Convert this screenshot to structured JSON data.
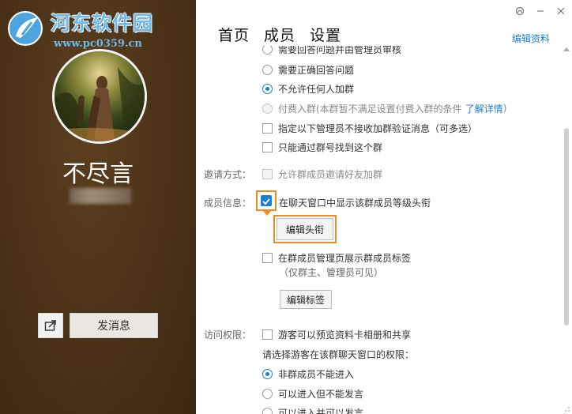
{
  "watermark": {
    "site_name": "河东软件园",
    "site_url": "www.pc0359.cn"
  },
  "profile": {
    "username": "不尽言"
  },
  "actions": {
    "send_message": "发消息"
  },
  "nav": {
    "tabs": [
      "首页",
      "成员",
      "设置"
    ],
    "edit_profile": "编辑资料"
  },
  "join_options": [
    {
      "label": "需要回答问题并由管理员审核",
      "state": "partial"
    },
    {
      "label": "需要正确回答问题",
      "state": "unchecked"
    },
    {
      "label": "不允许任何人加群",
      "state": "checked"
    },
    {
      "label": "付费入群(本群暂不满足设置付费入群的条件",
      "link": "了解详情",
      "suffix": ")",
      "state": "disabled"
    }
  ],
  "join_checks": [
    "指定以下管理员不接收加群验证消息（可多选）",
    "只能通过群号找到这个群"
  ],
  "invite": {
    "label": "邀请方式：",
    "option": "允许群成员邀请好友加群"
  },
  "member_info": {
    "label": "成员信息：",
    "show_level_title": "在聊天窗口中显示该群成员等级头衔",
    "edit_title_button": "编辑头衔",
    "show_tags": "在群成员管理页展示群成员标签",
    "tags_note": "（仅群主、管理员可见）",
    "edit_tags_button": "编辑标签"
  },
  "access": {
    "label": "访问权限：",
    "guest_preview": "游客可以预览资料卡相册和共享",
    "guest_prompt": "请选择游客在该群聊天窗口的权限：",
    "options": [
      {
        "label": "非群成员不能进入",
        "state": "checked"
      },
      {
        "label": "可以进入但不能发言",
        "state": "unchecked"
      },
      {
        "label": "可以进入并可以发言",
        "state": "partial"
      }
    ]
  },
  "colors": {
    "accent": "#1a7fd2",
    "highlight": "#f08a24",
    "left_panel_bg": "#4a3117"
  },
  "icons": [
    "window-skin-icon",
    "minimize-icon",
    "close-icon",
    "share-icon",
    "site-logo-icon",
    "check-icon"
  ]
}
